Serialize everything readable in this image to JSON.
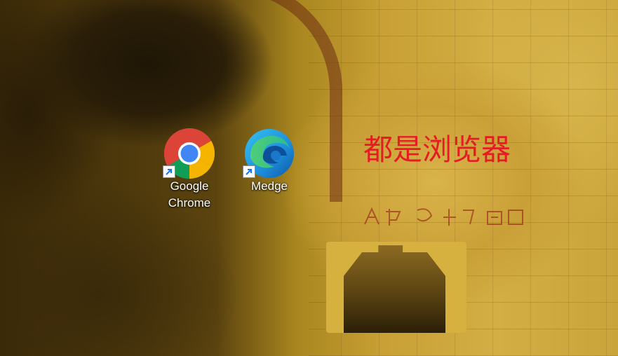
{
  "desktop": {
    "icons": [
      {
        "label": "Google\nChrome",
        "label_line1": "Google",
        "label_line2": "Chrome",
        "icon": "chrome-icon"
      },
      {
        "label": "Medge",
        "icon": "edge-icon"
      }
    ],
    "overlay_text": "都是浏览器",
    "overlay_color": "#e51c23"
  }
}
